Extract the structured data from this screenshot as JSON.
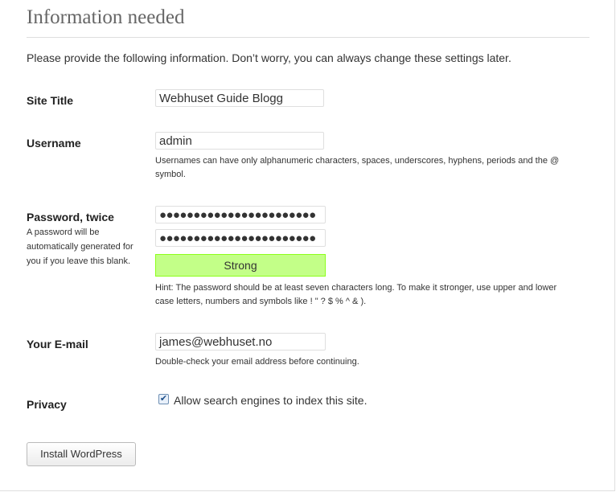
{
  "page": {
    "title": "Information needed",
    "intro": "Please provide the following information. Don’t worry, you can always change these settings later."
  },
  "site_title": {
    "label": "Site Title",
    "value": "Webhuset Guide Blogg"
  },
  "username": {
    "label": "Username",
    "value": "admin",
    "hint_line1": "Usernames can have only alphanumeric characters, spaces, underscores, hyphens, periods and the @",
    "hint_line2": "symbol."
  },
  "password": {
    "label": "Password, twice",
    "note_line1": "A password will be",
    "note_line2": "automatically generated for",
    "note_line3": "you if you leave this blank.",
    "masked_1": "●●●●●●●●●●●●●●●●●●●●●●●",
    "masked_2": "●●●●●●●●●●●●●●●●●●●●●●●",
    "strength": "Strong",
    "hint_line1": "Hint: The password should be at least seven characters long. To make it stronger, use upper and lower",
    "hint_line2": "case letters, numbers and symbols like ! \" ? $ % ^ & )."
  },
  "email": {
    "label": "Your E-mail",
    "value": "james@webhuset.no",
    "hint": "Double-check your email address before continuing."
  },
  "privacy": {
    "label": "Privacy",
    "checkbox_label": "Allow search engines to index this site.",
    "checked": true,
    "check_glyph": "✔"
  },
  "install_button": "Install WordPress",
  "colors": {
    "strength_bg": "#c3ff88",
    "strength_border": "#8dff1c",
    "heading": "#666666"
  }
}
